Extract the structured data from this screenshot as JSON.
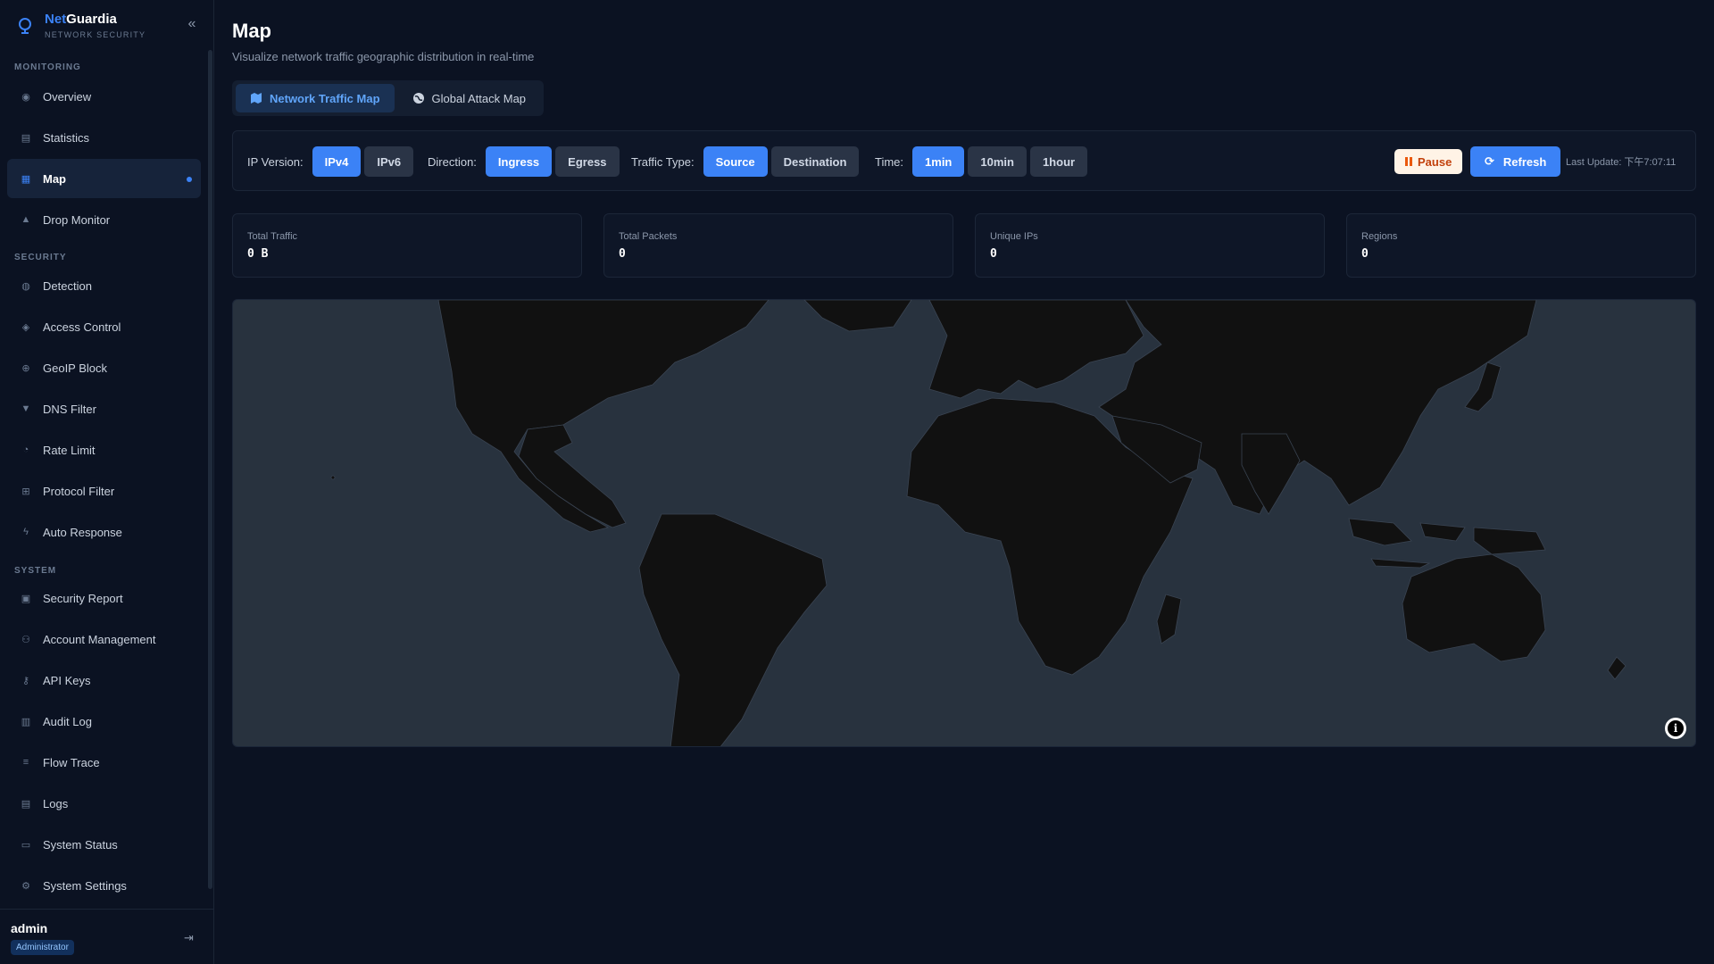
{
  "brand": {
    "name_part1": "Net",
    "name_part2": "Guardia",
    "subtitle": "NETWORK SECURITY"
  },
  "sidebar": {
    "sections": {
      "monitoring": "MONITORING",
      "security": "SECURITY",
      "system": "SYSTEM"
    },
    "items": [
      {
        "label": "Overview",
        "icon": "overview-icon"
      },
      {
        "label": "Statistics",
        "icon": "chart-icon"
      },
      {
        "label": "Map",
        "icon": "map-icon",
        "active": true
      },
      {
        "label": "Drop Monitor",
        "icon": "warning-icon"
      },
      {
        "label": "Detection",
        "icon": "radar-icon"
      },
      {
        "label": "Access Control",
        "icon": "shield-icon"
      },
      {
        "label": "GeoIP Block",
        "icon": "globe-icon"
      },
      {
        "label": "DNS Filter",
        "icon": "filter-icon"
      },
      {
        "label": "Rate Limit",
        "icon": "gauge-icon"
      },
      {
        "label": "Protocol Filter",
        "icon": "network-icon"
      },
      {
        "label": "Auto Response",
        "icon": "bolt-icon"
      },
      {
        "label": "Security Report",
        "icon": "document-icon"
      },
      {
        "label": "Account Management",
        "icon": "users-icon"
      },
      {
        "label": "API Keys",
        "icon": "key-icon"
      },
      {
        "label": "Audit Log",
        "icon": "clipboard-icon"
      },
      {
        "label": "Flow Trace",
        "icon": "list-icon"
      },
      {
        "label": "Logs",
        "icon": "file-icon"
      },
      {
        "label": "System Status",
        "icon": "monitor-icon"
      },
      {
        "label": "System Settings",
        "icon": "gear-icon"
      }
    ]
  },
  "user": {
    "name": "admin",
    "role": "Administrator"
  },
  "page": {
    "title": "Map",
    "subtitle": "Visualize network traffic geographic distribution in real-time"
  },
  "tabs": [
    {
      "label": "Network Traffic Map",
      "active": true
    },
    {
      "label": "Global Attack Map",
      "active": false
    }
  ],
  "filters": {
    "ip_version": {
      "label": "IP Version:",
      "options": [
        "IPv4",
        "IPv6"
      ],
      "selected": "IPv4"
    },
    "direction": {
      "label": "Direction:",
      "options": [
        "Ingress",
        "Egress"
      ],
      "selected": "Ingress"
    },
    "traffic_type": {
      "label": "Traffic Type:",
      "options": [
        "Source",
        "Destination"
      ],
      "selected": "Source"
    },
    "time": {
      "label": "Time:",
      "options": [
        "1min",
        "10min",
        "1hour"
      ],
      "selected": "1min"
    }
  },
  "actions": {
    "pause": "Pause",
    "refresh": "Refresh",
    "last_update": "Last Update: 下午7:07:11"
  },
  "stats": [
    {
      "label": "Total Traffic",
      "value": "0 B"
    },
    {
      "label": "Total Packets",
      "value": "0"
    },
    {
      "label": "Unique IPs",
      "value": "0"
    },
    {
      "label": "Regions",
      "value": "0"
    }
  ],
  "map": {
    "info_symbol": "i"
  },
  "colors": {
    "accent": "#3b82f6",
    "ocean": "#28323e",
    "land": "#111111",
    "background": "#0b1222"
  }
}
